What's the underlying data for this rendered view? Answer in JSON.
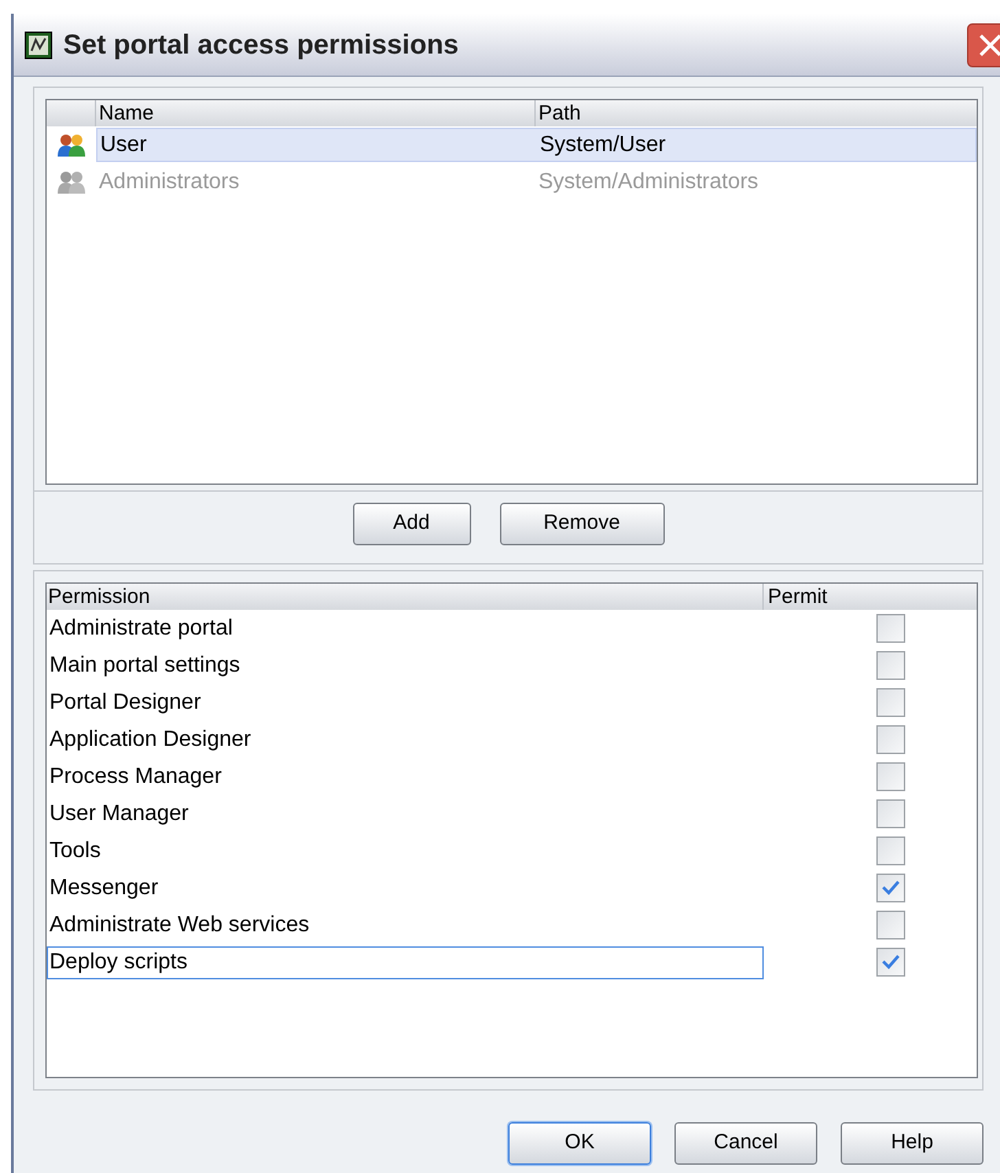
{
  "window": {
    "title": "Set portal access permissions"
  },
  "principals": {
    "columns": [
      "Name",
      "Path"
    ],
    "rows": [
      {
        "name": "User",
        "path": "System/User",
        "selected": true,
        "disabled": false
      },
      {
        "name": "Administrators",
        "path": "System/Administrators",
        "selected": false,
        "disabled": true
      }
    ]
  },
  "principal_buttons": [
    "Add",
    "Remove"
  ],
  "permissions": {
    "columns": [
      "Permission",
      "Permit"
    ],
    "rows": [
      {
        "label": "Administrate portal",
        "checked": false,
        "focused": false
      },
      {
        "label": "Main portal settings",
        "checked": false,
        "focused": false
      },
      {
        "label": "Portal Designer",
        "checked": false,
        "focused": false
      },
      {
        "label": "Application Designer",
        "checked": false,
        "focused": false
      },
      {
        "label": "Process Manager",
        "checked": false,
        "focused": false
      },
      {
        "label": "User Manager",
        "checked": false,
        "focused": false
      },
      {
        "label": "Tools",
        "checked": false,
        "focused": false
      },
      {
        "label": "Messenger",
        "checked": true,
        "focused": false
      },
      {
        "label": "Administrate Web services",
        "checked": false,
        "focused": false
      },
      {
        "label": "Deploy scripts",
        "checked": true,
        "focused": true
      }
    ]
  },
  "dialog_buttons": [
    {
      "label": "OK",
      "default": true
    },
    {
      "label": "Cancel",
      "default": false
    },
    {
      "label": "Help",
      "default": false
    }
  ]
}
